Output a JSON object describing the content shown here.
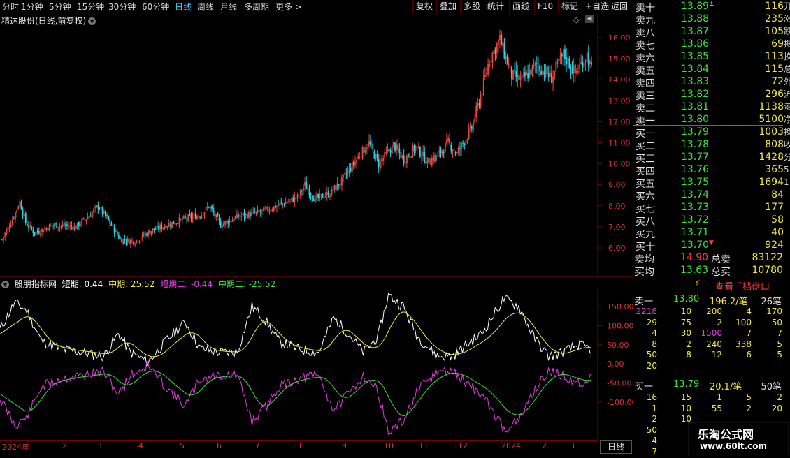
{
  "toolbar": {
    "periods": [
      "分时",
      "1分钟",
      "5分钟",
      "15分钟",
      "30分钟",
      "60分钟",
      "日线",
      "周线",
      "月线",
      "多周期",
      "更多 >"
    ],
    "active_period": "日线",
    "right_buttons": [
      "复权",
      "叠加",
      "多股",
      "统计",
      "画线",
      "F10",
      "标记",
      "+自选",
      "返回"
    ]
  },
  "title": {
    "stock": "精达股份(日线,前复权)",
    "diamond": "◇"
  },
  "price_axis": {
    "ticks": [
      "16.00",
      "15.00",
      "14.00",
      "13.00",
      "12.00",
      "11.00",
      "10.00",
      "9.00",
      "8.00",
      "7.00",
      "6.00"
    ],
    "values": [
      16,
      15,
      14,
      13,
      12,
      11,
      10,
      9,
      8,
      7,
      6
    ]
  },
  "indicator": {
    "name": "股朋指标网",
    "short_label": "短期: 0.44",
    "mid_label": "中期: 25.52",
    "short2_label": "短期二: -0.44",
    "mid2_label": "中期二: -25.52",
    "colors": {
      "short": "#ffffff",
      "mid": "#f2e93a",
      "short2": "#e03ce0",
      "mid2": "#3ce23c"
    },
    "axis_ticks": [
      "150.00",
      "100.00",
      "50.00",
      "0.00",
      "-50.00",
      "-100.00"
    ],
    "axis_values": [
      150,
      100,
      50,
      0,
      -50,
      -100
    ]
  },
  "x_axis": {
    "labels": [
      "2024年",
      "2",
      "3",
      "4",
      "5",
      "6",
      "7",
      "8",
      "9",
      "10",
      "11",
      "12",
      "2024",
      "2",
      "3"
    ]
  },
  "period_box": "日线",
  "orderbook": {
    "asks": [
      {
        "label": "卖十",
        "price": "13.89",
        "vol": "116"
      },
      {
        "label": "卖九",
        "price": "13.88",
        "vol": "235"
      },
      {
        "label": "卖八",
        "price": "13.87",
        "vol": "105"
      },
      {
        "label": "卖七",
        "price": "13.86",
        "vol": "69"
      },
      {
        "label": "卖六",
        "price": "13.85",
        "vol": "113"
      },
      {
        "label": "卖五",
        "price": "13.84",
        "vol": "115"
      },
      {
        "label": "卖四",
        "price": "13.83",
        "vol": "72"
      },
      {
        "label": "卖三",
        "price": "13.82",
        "vol": "296"
      },
      {
        "label": "卖二",
        "price": "13.81",
        "vol": "1138"
      },
      {
        "label": "卖一",
        "price": "13.80",
        "vol": "5100"
      }
    ],
    "bids": [
      {
        "label": "买一",
        "price": "13.79",
        "vol": "1003"
      },
      {
        "label": "买二",
        "price": "13.78",
        "vol": "808"
      },
      {
        "label": "买三",
        "price": "13.77",
        "vol": "1428"
      },
      {
        "label": "买四",
        "price": "13.76",
        "vol": "365"
      },
      {
        "label": "买五",
        "price": "13.75",
        "vol": "1694"
      },
      {
        "label": "买六",
        "price": "13.74",
        "vol": "84"
      },
      {
        "label": "买七",
        "price": "13.73",
        "vol": "177"
      },
      {
        "label": "买八",
        "price": "13.72",
        "vol": "58"
      },
      {
        "label": "买九",
        "price": "13.71",
        "vol": "40"
      },
      {
        "label": "买十",
        "price": "13.70",
        "vol": "924"
      }
    ],
    "sell_avg_label": "卖均",
    "sell_avg": "14.90",
    "total_sell_label": "总卖",
    "total_sell": "83122",
    "buy_avg_label": "买均",
    "buy_avg": "13.63",
    "total_buy_label": "总买",
    "total_buy": "10780"
  },
  "thousand_link": "查看千档盘口",
  "queue": {
    "ask_label": "卖一",
    "ask_price": "13.80",
    "ask_per": "196.2/笔",
    "ask_count": "26笔",
    "ask_rows": [
      [
        "2218",
        "10",
        "200",
        "4",
        "170"
      ],
      [
        "29",
        "75",
        "2",
        "100",
        "50"
      ],
      [
        "4",
        "30",
        "1500",
        "7",
        "7"
      ],
      [
        "8",
        "2",
        "240",
        "338",
        "5"
      ],
      [
        "50",
        "8",
        "12",
        "6",
        "5"
      ],
      [
        "20",
        "",
        "",
        "",
        ""
      ]
    ],
    "bid_label": "买一",
    "bid_price": "13.79",
    "bid_per": "20.1/笔",
    "bid_count": "50笔",
    "bid_rows": [
      [
        "16",
        "15",
        "1",
        "5",
        "2"
      ],
      [
        "1",
        "10",
        "55",
        "2",
        "20"
      ],
      [
        "2",
        "10",
        "",
        "",
        ""
      ],
      [
        "50",
        "",
        "",
        "",
        ""
      ],
      [
        "4",
        "",
        "",
        "",
        ""
      ],
      [
        "7",
        "",
        "",
        "",
        ""
      ]
    ]
  },
  "watermark": {
    "line1": "乐淘公式网",
    "line2": "www.60lt.com"
  },
  "edge_chars": [
    "开",
    "涨",
    "跌",
    "振",
    "换",
    "总",
    "外",
    "流",
    "资",
    "净",
    "换",
    "收",
    "分",
    "5",
    "1"
  ]
}
